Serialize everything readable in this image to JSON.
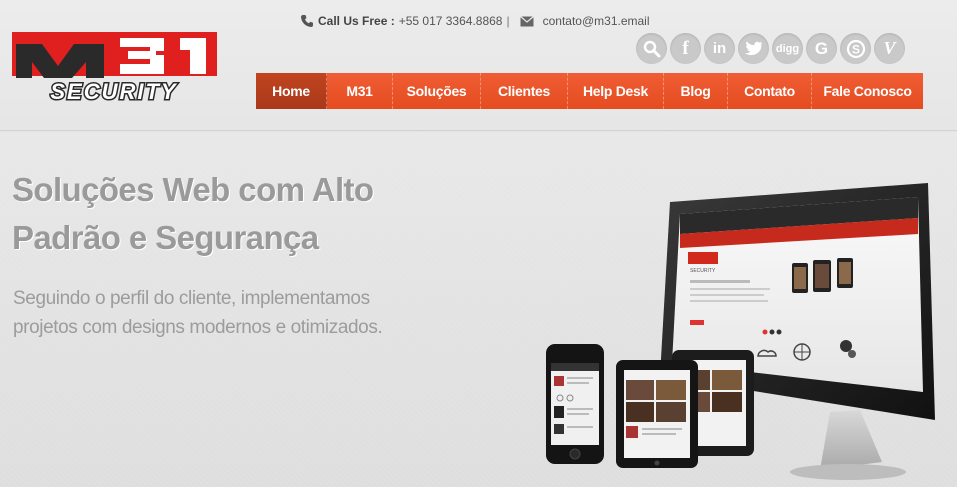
{
  "logo": {
    "brand_top": "M31",
    "brand_bottom": "SECURITY"
  },
  "contact": {
    "phone_label": "Call Us Free :",
    "phone_number": "+55 017 3364.8868",
    "separator": "|",
    "email": "contato@m31.email"
  },
  "social": [
    {
      "name": "search-icon",
      "glyph": "⚲"
    },
    {
      "name": "facebook-icon",
      "glyph": "f"
    },
    {
      "name": "linkedin-icon",
      "glyph": "in"
    },
    {
      "name": "twitter-icon",
      "glyph": "t"
    },
    {
      "name": "digg-icon",
      "glyph": "digg"
    },
    {
      "name": "google-icon",
      "glyph": "G"
    },
    {
      "name": "skype-icon",
      "glyph": "S"
    },
    {
      "name": "vimeo-icon",
      "glyph": "V"
    }
  ],
  "nav": {
    "items": [
      "Home",
      "M31",
      "Soluções",
      "Clientes",
      "Help Desk",
      "Blog",
      "Contato",
      "Fale Conosco"
    ],
    "active": "Home"
  },
  "hero": {
    "title_line1": "Soluções Web com Alto",
    "title_line2": "Padrão e Segurança",
    "subtitle_line1": "Seguindo o perfil do cliente,  implementamos",
    "subtitle_line2": "projetos com designs modernos e otimizados."
  },
  "colors": {
    "accent": "#e84f22",
    "accent_active": "#b13d1c",
    "logo_red": "#e0201e",
    "logo_dark": "#2a2a2a",
    "text_gray": "#9a9a9a"
  }
}
